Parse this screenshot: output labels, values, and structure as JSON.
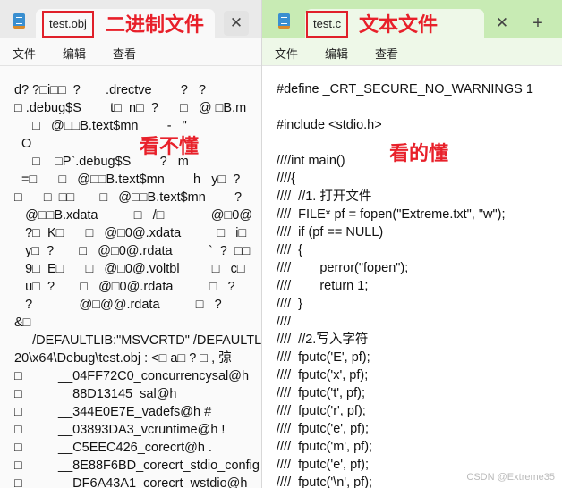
{
  "left": {
    "tab_title": "test.obj",
    "annotation": "二进制文件",
    "overlay": "看不懂",
    "menu": [
      "文件",
      "编辑",
      "查看"
    ],
    "lines": [
      "d? ?□i□□  ?       .drectve        ?   ?",
      "□ .debug$S        t□  n□  ?      □   @ □B.m",
      "     □   @□□B.text$mn        -   \"",
      "  O",
      "     □    □P`.debug$S        ?   m",
      "  =□      □   @□□B.text$mn        h   y□  ?",
      "□      □  □□       □   @□□B.text$mn        ?",
      "   @□□B.xdata          □   /□             @□0@",
      "   ?□  K□      □   @□0@.xdata          □   i□",
      "   y□  ?       □   @□0@.rdata          `  ?  □□",
      "   9□  E□      □   @□0@.voltbl         □   c□",
      "   u□  ?       □   @□0@.rdata          □   ?",
      "   ?             @□@@.rdata          □   ?",
      "&□",
      "     /DEFAULTLIB:\"MSVCRTD\" /DEFAULTLIB",
      "20\\x64\\Debug\\test.obj : <□ a□ ? □ , 弶",
      "□          __04FF72C0_concurrencysal@h",
      "□          __88D13145_sal@h",
      "□          __344E0E7E_vadefs@h #",
      "□          __03893DA3_vcruntime@h !",
      "□          __C5EEC426_corecrt@h .",
      "□          __8E88F6BD_corecrt_stdio_config",
      "□          __DF6A43A1_corecrt_wstdio@h"
    ]
  },
  "right": {
    "tab_title": "test.c",
    "annotation": "文本文件",
    "overlay": "看的懂",
    "new_tab": "+",
    "menu": [
      "文件",
      "编辑",
      "查看"
    ],
    "lines": [
      "#define _CRT_SECURE_NO_WARNINGS 1",
      "",
      "#include <stdio.h>",
      "",
      "////int main()",
      "////{",
      "////  //1. 打开文件",
      "////  FILE* pf = fopen(\"Extreme.txt\", \"w\");",
      "////  if (pf == NULL)",
      "////  {",
      "////        perror(\"fopen\");",
      "////        return 1;",
      "////  }",
      "////",
      "////  //2.写入字符",
      "////  fputc('E', pf);",
      "////  fputc('x', pf);",
      "////  fputc('t', pf);",
      "////  fputc('r', pf);",
      "////  fputc('e', pf);",
      "////  fputc('m', pf);",
      "////  fputc('e', pf);",
      "////  fputc('\\n', pf);"
    ]
  },
  "close_glyph": "✕",
  "watermark": "CSDN @Extreme35"
}
